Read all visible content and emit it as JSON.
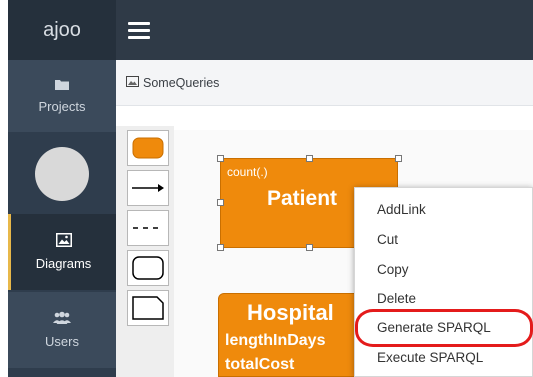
{
  "app": {
    "brand": "ajoo"
  },
  "sidebar": {
    "items": [
      {
        "label": "Projects",
        "icon": "folder-icon"
      },
      {
        "label": "",
        "icon": "avatar"
      },
      {
        "label": "Diagrams",
        "icon": "image-icon",
        "active": true
      },
      {
        "label": "Users",
        "icon": "users-icon"
      }
    ]
  },
  "breadcrumb": {
    "label": "SomeQueries",
    "icon": "image-icon"
  },
  "palette": [
    "class-node-tool",
    "link-arrow-tool",
    "dashed-link-tool",
    "rounded-box-tool",
    "note-box-tool"
  ],
  "diagram": {
    "patient": {
      "attribute": "count(.)",
      "title": "Patient"
    },
    "hospital": {
      "title": "Hospital",
      "attributes": [
        "lengthInDays",
        "totalCost"
      ]
    }
  },
  "context_menu": {
    "items": [
      "AddLink",
      "Cut",
      "Copy",
      "Delete",
      "Generate SPARQL",
      "Execute SPARQL"
    ],
    "highlighted": "Generate SPARQL"
  },
  "colors": {
    "node_fill": "#ef8a0c",
    "highlight": "#e41b1b",
    "sidebar": "#2f3d4d",
    "active_accent": "#e8b84a"
  }
}
